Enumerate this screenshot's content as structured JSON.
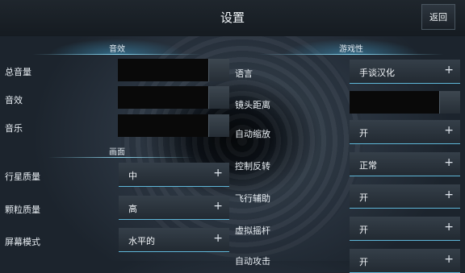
{
  "header": {
    "title": "设置",
    "back_label": "返回"
  },
  "sections": {
    "audio": "音效",
    "graphics": "画面",
    "game": "游戏性"
  },
  "audio": {
    "master": "总音量",
    "sfx": "音效",
    "music": "音乐"
  },
  "graphics": {
    "planet_quality": {
      "label": "行星质量",
      "value": "中"
    },
    "particle_quality": {
      "label": "颗粒质量",
      "value": "高"
    },
    "screen_mode": {
      "label": "屏幕模式",
      "value": "水平的"
    }
  },
  "game": {
    "language": {
      "label": "语言",
      "value": "手谈汉化"
    },
    "camera_distance": {
      "label": "镜头距离"
    },
    "auto_zoom": {
      "label": "自动缩放",
      "value": "开"
    },
    "invert_controls": {
      "label": "控制反转",
      "value": "正常"
    },
    "flight_assist": {
      "label": "飞行辅助",
      "value": "开"
    },
    "virtual_joystick": {
      "label": "虚拟摇杆",
      "value": "开"
    },
    "partial_next": {
      "label": "自动攻击",
      "value": "开"
    }
  },
  "icons": {
    "dropdown": "plus-icon"
  }
}
